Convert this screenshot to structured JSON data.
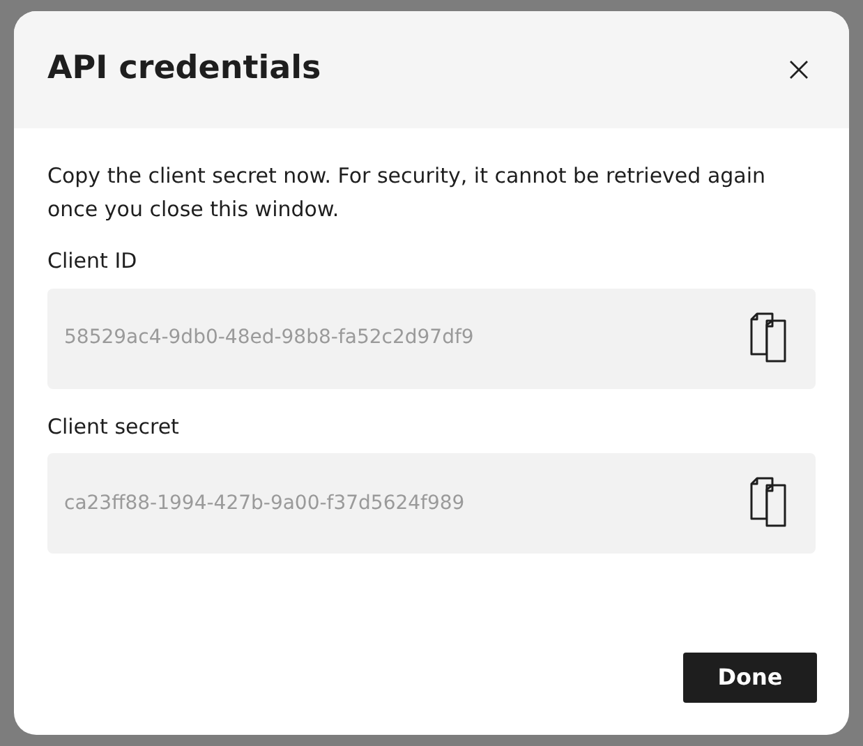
{
  "dialog": {
    "title": "API credentials",
    "message": "Copy the client secret now. For security, it cannot be retrieved again once you close this window.",
    "fields": [
      {
        "label": "Client ID",
        "value": "58529ac4-9db0-48ed-98b8-fa52c2d97df9",
        "blurred": true
      },
      {
        "label": "Client secret",
        "value": "ca23ff88-1994-427b-9a00-f37d5624f989",
        "blurred": true
      }
    ],
    "buttons": [
      "Done"
    ]
  }
}
